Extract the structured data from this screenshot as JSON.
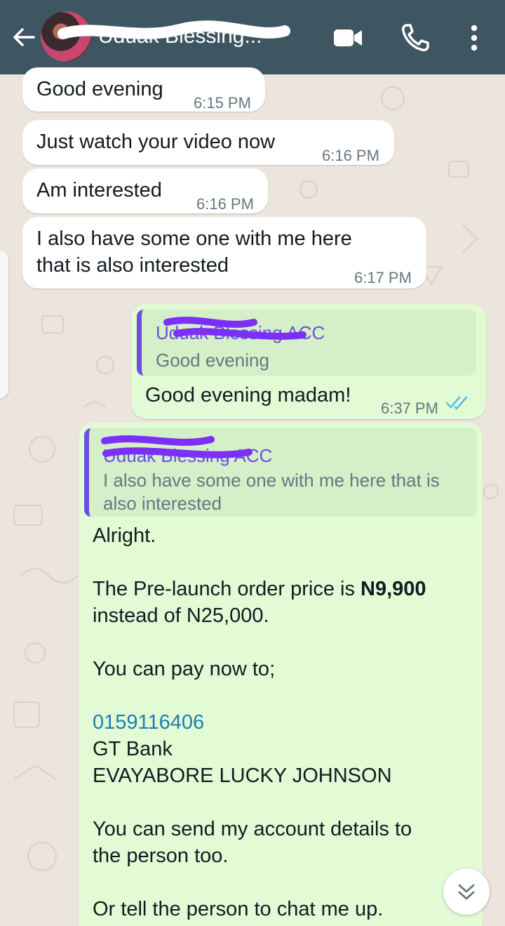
{
  "header": {
    "contact_name": "Uduak Blessing...",
    "icons": [
      "back-arrow-icon",
      "video-call-icon",
      "voice-call-icon",
      "more-options-icon"
    ],
    "background": "#3d5662"
  },
  "messages": [
    {
      "direction": "incoming",
      "text": "Good evening",
      "time": "6:15 PM"
    },
    {
      "direction": "incoming",
      "text": "Just watch your video now",
      "time": "6:16 PM"
    },
    {
      "direction": "incoming",
      "text": "Am interested",
      "time": "6:16 PM"
    },
    {
      "direction": "incoming",
      "lines": [
        "I also have some one with me here",
        "that is also interested"
      ],
      "time": "6:17 PM"
    },
    {
      "direction": "outgoing",
      "quote": {
        "author": "Uduak Blessing ACC",
        "text": "Good evening"
      },
      "text": "Good evening madam!",
      "time": "6:37 PM",
      "status": "read"
    },
    {
      "direction": "outgoing",
      "quote": {
        "author": "Uduak Blessing ACC",
        "lines": [
          "I also have some one with me here that is",
          "also interested"
        ]
      },
      "body": {
        "l1": "Alright.",
        "l2a": "The Pre-launch order price is ",
        "l2b": "N9,900",
        "l3": "instead of N25,000.",
        "l4": "You can pay now to;",
        "account_number": "0159116406",
        "bank": "GT Bank",
        "account_name": "EVAYABORE LUCKY JOHNSON",
        "l5": "You can send my account details to",
        "l6": "the person too.",
        "l7": "Or tell the person to chat me up."
      }
    }
  ],
  "colors": {
    "incoming_bubble": "#ffffff",
    "outgoing_bubble": "#e2fbd4",
    "quote_accent": "#6b4fe0",
    "link": "#1b7fb5",
    "read_ticks": "#53bdeb",
    "redaction": "#7b2ff7"
  }
}
